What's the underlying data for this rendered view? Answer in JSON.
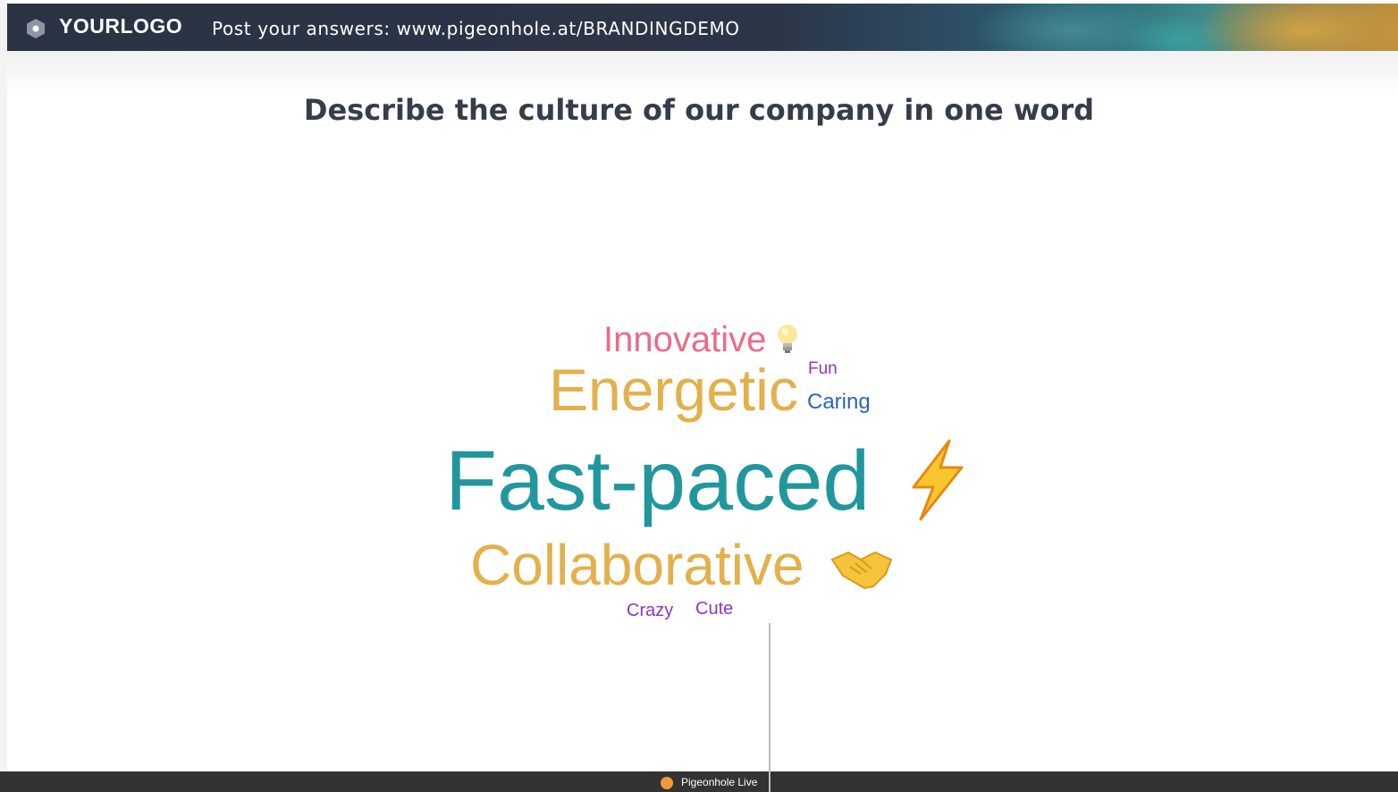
{
  "header": {
    "logo_text": "YOURLOGO",
    "post_prompt": "Post your answers: www.pigeonhole.at/BRANDINGDEMO",
    "logo_icon": "hexagon-logo-icon"
  },
  "question": "Describe the culture of our company in one word",
  "word_cloud": [
    {
      "text": "Innovative",
      "emoji": "lightbulb-icon",
      "color": "#ec6b87"
    },
    {
      "text": "Fun",
      "color": "#8c35c7"
    },
    {
      "text": "Energetic",
      "color": "#e3b04c"
    },
    {
      "text": "Caring",
      "color": "#2a64c2"
    },
    {
      "text": "Fast-paced",
      "emoji": "lightning-bolt-icon",
      "color": "#21979d"
    },
    {
      "text": "Collaborative",
      "emoji": "handshake-icon",
      "color": "#e3b04c"
    },
    {
      "text": "Crazy",
      "color": "#8c35c7"
    },
    {
      "text": "Cute",
      "color": "#8c35c7"
    }
  ],
  "footer": {
    "brand_text": "Pigeonhole Live",
    "brand_icon": "pigeonhole-logo-icon"
  }
}
